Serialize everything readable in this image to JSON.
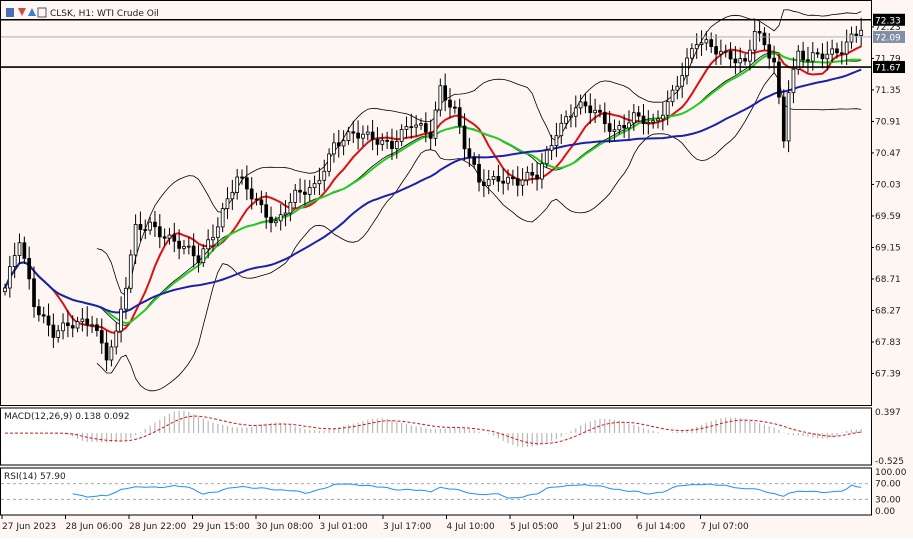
{
  "header": {
    "symbol_text": "CLSK, H1:  WTI Crude Oil"
  },
  "chart_data": [
    {
      "type": "candlestick",
      "symbol": "CLSK",
      "timeframe": "H1",
      "title": "WTI Crude Oil",
      "price_axis_ticks": [
        "72.23",
        "71.79",
        "71.35",
        "70.91",
        "70.47",
        "70.03",
        "69.59",
        "69.15",
        "68.71",
        "68.27",
        "67.83",
        "67.39"
      ],
      "price_axis_ticks_values": [
        72.23,
        71.79,
        71.35,
        70.91,
        70.47,
        70.03,
        69.59,
        69.15,
        68.71,
        68.27,
        67.83,
        67.39
      ],
      "ylim": [
        66.95,
        72.55
      ],
      "price_tags": [
        {
          "value": 72.33,
          "label": "72.33",
          "kind": "level",
          "color": "#000000"
        },
        {
          "value": 72.09,
          "label": "72.09",
          "kind": "bid",
          "color": "#7f8fa6"
        },
        {
          "value": 71.67,
          "label": "71.67",
          "kind": "level",
          "color": "#000000"
        }
      ],
      "horizontal_levels": [
        72.33,
        71.67
      ],
      "time_axis_labels": [
        "27 Jun 2023",
        "28 Jun 06:00",
        "28 Jun 22:00",
        "29 Jun 15:00",
        "30 Jun 08:00",
        "3 Jul 01:00",
        "3 Jul 17:00",
        "4 Jul 10:00",
        "5 Jul 05:00",
        "5 Jul 21:00",
        "6 Jul 14:00",
        "7 Jul 07:00"
      ],
      "bar_count": 178,
      "close_anchors": [
        [
          0,
          68.55
        ],
        [
          3,
          69.25
        ],
        [
          6,
          68.4
        ],
        [
          10,
          67.95
        ],
        [
          14,
          68.05
        ],
        [
          18,
          68.15
        ],
        [
          21,
          67.65
        ],
        [
          23,
          67.9
        ],
        [
          25,
          68.6
        ],
        [
          27,
          69.4
        ],
        [
          30,
          69.5
        ],
        [
          35,
          69.2
        ],
        [
          40,
          69.0
        ],
        [
          44,
          69.5
        ],
        [
          48,
          70.1
        ],
        [
          52,
          69.8
        ],
        [
          56,
          69.5
        ],
        [
          60,
          69.85
        ],
        [
          64,
          70.0
        ],
        [
          68,
          70.6
        ],
        [
          72,
          70.7
        ],
        [
          76,
          70.7
        ],
        [
          80,
          70.6
        ],
        [
          84,
          70.85
        ],
        [
          88,
          70.75
        ],
        [
          90,
          71.4
        ],
        [
          93,
          71.05
        ],
        [
          95,
          70.55
        ],
        [
          98,
          70.05
        ],
        [
          102,
          70.15
        ],
        [
          106,
          70.05
        ],
        [
          110,
          70.15
        ],
        [
          114,
          70.8
        ],
        [
          118,
          71.1
        ],
        [
          122,
          71.05
        ],
        [
          126,
          70.8
        ],
        [
          130,
          70.95
        ],
        [
          134,
          70.85
        ],
        [
          137,
          71.2
        ],
        [
          140,
          71.6
        ],
        [
          143,
          72.0
        ],
        [
          146,
          71.95
        ],
        [
          150,
          71.85
        ],
        [
          153,
          71.7
        ],
        [
          155,
          72.15
        ],
        [
          157,
          71.95
        ],
        [
          159,
          71.75
        ],
        [
          161,
          70.7
        ],
        [
          162,
          71.4
        ],
        [
          164,
          71.85
        ],
        [
          166,
          71.75
        ],
        [
          170,
          71.85
        ],
        [
          173,
          71.95
        ],
        [
          175,
          72.1
        ],
        [
          177,
          72.2
        ]
      ],
      "moving_averages": [
        {
          "name": "MA fast",
          "color": "#dd1111",
          "period": 10
        },
        {
          "name": "MA mid",
          "color": "#22cc22",
          "period": 21
        },
        {
          "name": "MA slow",
          "color": "#1a22a8",
          "period": 50
        }
      ],
      "bollinger_bands": {
        "period": 20,
        "deviation": 2,
        "color": "#000000"
      }
    },
    {
      "type": "histogram",
      "indicator": "MACD",
      "label": "MACD(12,26,9) 0.138 0.092",
      "params": [
        12,
        26,
        9
      ],
      "macd_value": 0.138,
      "signal_value": 0.092,
      "ticks": [
        "0.397",
        "-0.525"
      ],
      "ticks_values": [
        0.397,
        -0.525
      ],
      "histogram_color": "#b8b8b8",
      "signal_color": "#dd1111"
    },
    {
      "type": "line",
      "indicator": "RSI",
      "label": "RSI(14) 57.90",
      "period": 14,
      "value": 57.9,
      "ticks": [
        "100.00",
        "70.00",
        "30.00",
        "0.00"
      ],
      "ticks_values": [
        100,
        70,
        30,
        0
      ],
      "line_color": "#1e90ff"
    }
  ]
}
